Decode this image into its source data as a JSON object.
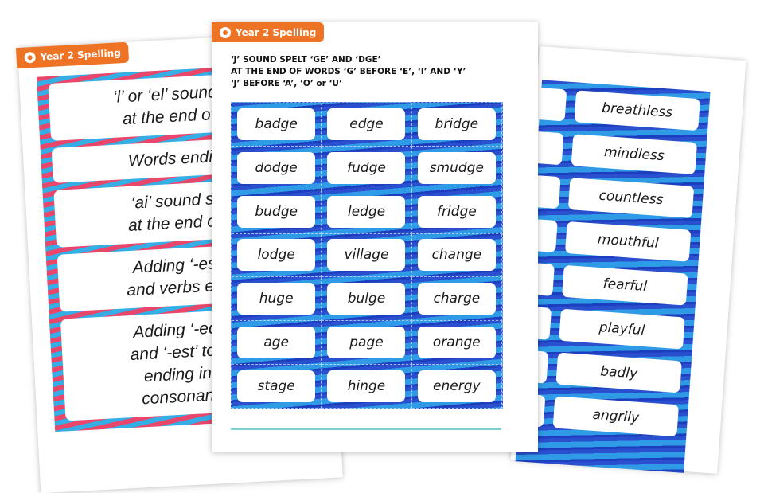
{
  "product_tag": "Year 2 Spelling",
  "left_sheet": {
    "tab_label": "Year 2 Spelling",
    "cards": [
      "‘l’ or ‘el’ sound sp\nat the end of w",
      "Words ending",
      "‘ai’ sound spe\nat the end of w",
      "Adding ‘-es’ to\nand verbs endin",
      "Adding ‘-ed’, ‘-i\nand ‘-est’ to a ro\nending in ‘-y’\nconsonant be"
    ]
  },
  "center_sheet": {
    "tab_label": "Year 2 Spelling",
    "heading_lines": [
      "‘J’ SOUND SPELT ‘GE’ AND ‘DGE’",
      "AT THE END OF WORDS ‘G’ BEFORE ‘E’, ‘I’ AND ‘Y’",
      "‘J’ BEFORE ‘A’, ‘O’ or ‘U’"
    ],
    "words": [
      "badge",
      "edge",
      "bridge",
      "dodge",
      "fudge",
      "smudge",
      "budge",
      "ledge",
      "fridge",
      "lodge",
      "village",
      "change",
      "huge",
      "bulge",
      "charge",
      "age",
      "page",
      "orange",
      "stage",
      "hinge",
      "energy"
    ]
  },
  "right_sheet": {
    "words": [
      "breathless",
      "mindless",
      "countless",
      "mouthful",
      "fearful",
      "playful",
      "badly",
      "angrily"
    ]
  },
  "colors": {
    "tab_orange": "#ee7325",
    "card_blue": "#2f9be6",
    "card_navy": "#2a4fcf",
    "card_pink": "#e8466b",
    "accent_teal": "#7ecfd3"
  }
}
